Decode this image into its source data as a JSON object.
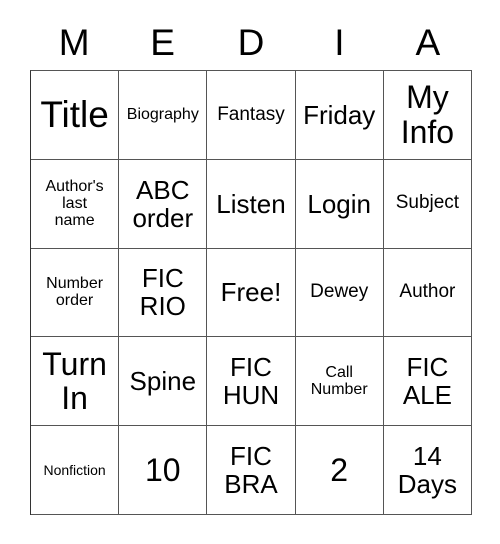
{
  "card": {
    "header_letters": [
      "M",
      "E",
      "D",
      "I",
      "A"
    ],
    "rows": [
      [
        {
          "text": "Title",
          "size": "fs-xl"
        },
        {
          "text": "Biography",
          "size": "fs-xs"
        },
        {
          "text": "Fantasy",
          "size": "fs-sm"
        },
        {
          "text": "Friday",
          "size": "fs-md"
        },
        {
          "text": "My\nInfo",
          "size": "fs-lg"
        }
      ],
      [
        {
          "text": "Author's\nlast\nname",
          "size": "fs-xs"
        },
        {
          "text": "ABC\norder",
          "size": "fs-md"
        },
        {
          "text": "Listen",
          "size": "fs-md"
        },
        {
          "text": "Login",
          "size": "fs-md"
        },
        {
          "text": "Subject",
          "size": "fs-sm"
        }
      ],
      [
        {
          "text": "Number\norder",
          "size": "fs-xs"
        },
        {
          "text": "FIC\nRIO",
          "size": "fs-md"
        },
        {
          "text": "Free!",
          "size": "fs-md"
        },
        {
          "text": "Dewey",
          "size": "fs-sm"
        },
        {
          "text": "Author",
          "size": "fs-sm"
        }
      ],
      [
        {
          "text": "Turn\nIn",
          "size": "fs-lg"
        },
        {
          "text": "Spine",
          "size": "fs-md"
        },
        {
          "text": "FIC\nHUN",
          "size": "fs-md"
        },
        {
          "text": "Call\nNumber",
          "size": "fs-xs"
        },
        {
          "text": "FIC\nALE",
          "size": "fs-md"
        }
      ],
      [
        {
          "text": "Nonfiction",
          "size": "fs-xxs"
        },
        {
          "text": "10",
          "size": "fs-lg"
        },
        {
          "text": "FIC\nBRA",
          "size": "fs-md"
        },
        {
          "text": "2",
          "size": "fs-lg"
        },
        {
          "text": "14\nDays",
          "size": "fs-md"
        }
      ]
    ],
    "colors": {
      "background": "#ffffff",
      "text": "#000000",
      "grid_line": "#555555"
    }
  }
}
